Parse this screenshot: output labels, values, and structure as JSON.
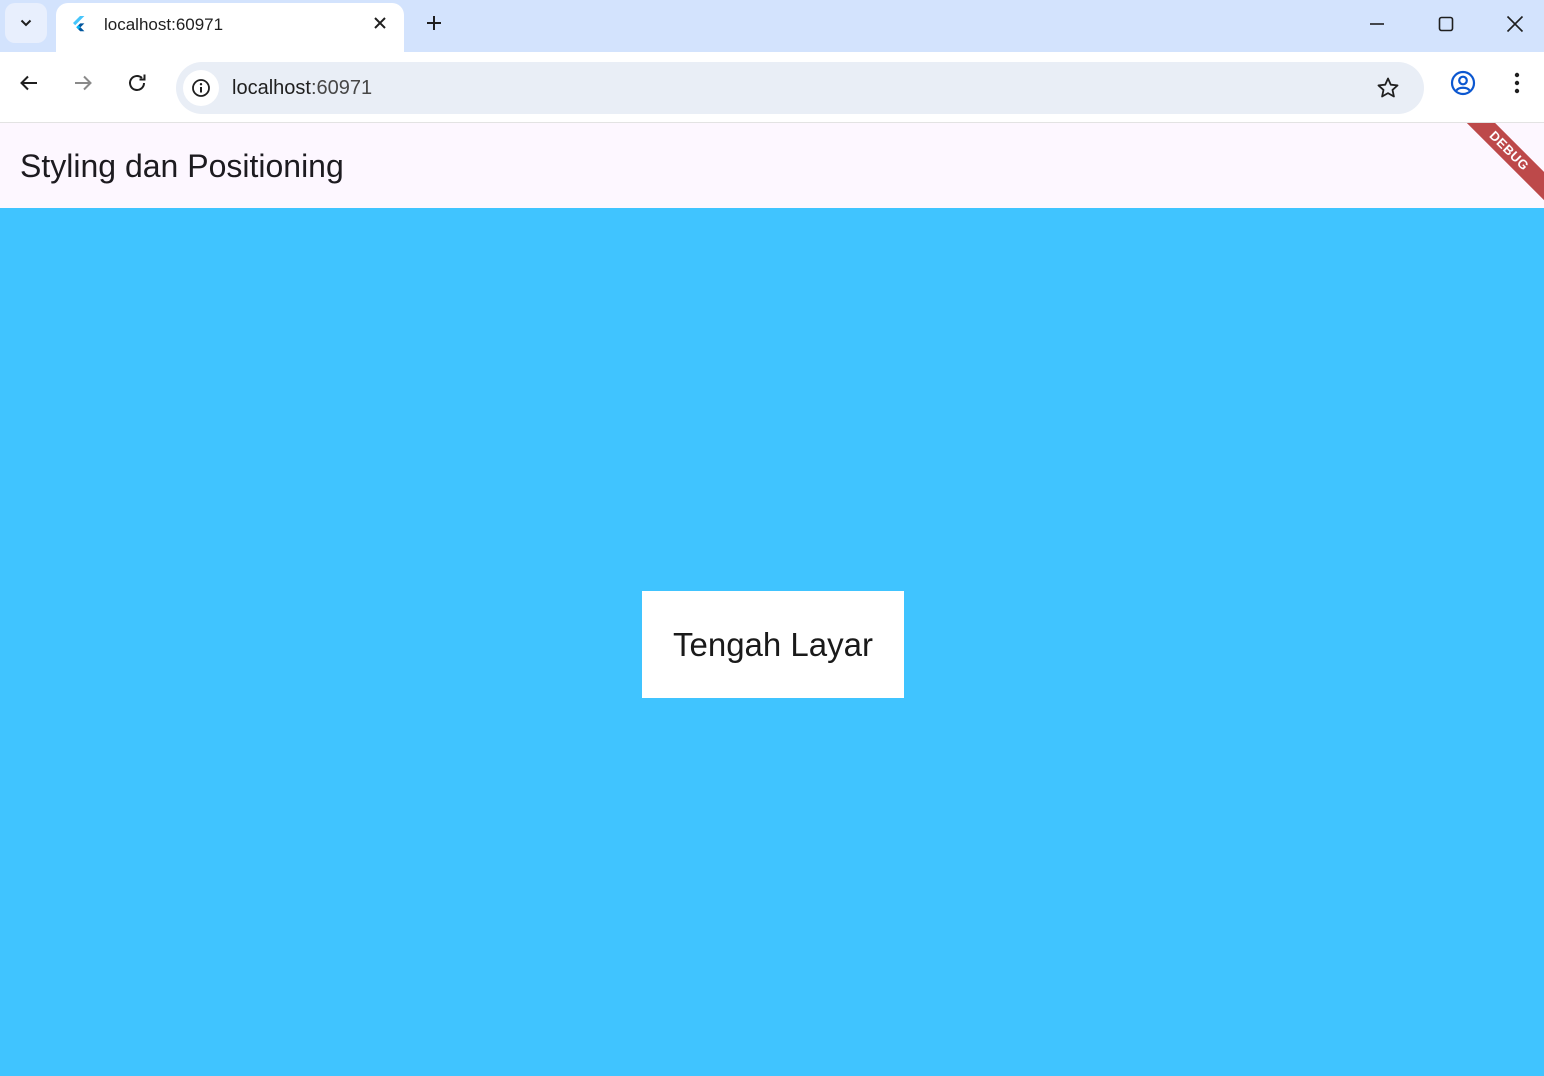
{
  "browser": {
    "tab": {
      "title": "localhost:60971",
      "favicon": "flutter-icon"
    },
    "address_bar": {
      "host": "localhost",
      "port": ":60971"
    },
    "icons": {
      "tab_search": "chevron-down-icon",
      "tab_close": "close-icon",
      "new_tab": "plus-icon",
      "minimize": "minimize-icon",
      "maximize": "maximize-icon",
      "close_window": "close-icon",
      "back": "arrow-left-icon",
      "forward": "arrow-right-icon",
      "reload": "reload-icon",
      "site_info": "info-icon",
      "bookmark": "star-icon",
      "profile": "account-icon",
      "menu": "more-vert-icon"
    },
    "colors": {
      "tab_strip": "#D3E3FD",
      "omnibox": "#E9EEF6"
    }
  },
  "app": {
    "title": "Styling dan Positioning",
    "debug_banner": "DEBUG",
    "body": {
      "center_text": "Tengah Layar"
    },
    "colors": {
      "app_bar": "#FDF7FF",
      "background": "#40C4FF",
      "box": "#FFFFFF",
      "debug_banner": "#B22B2B"
    }
  }
}
